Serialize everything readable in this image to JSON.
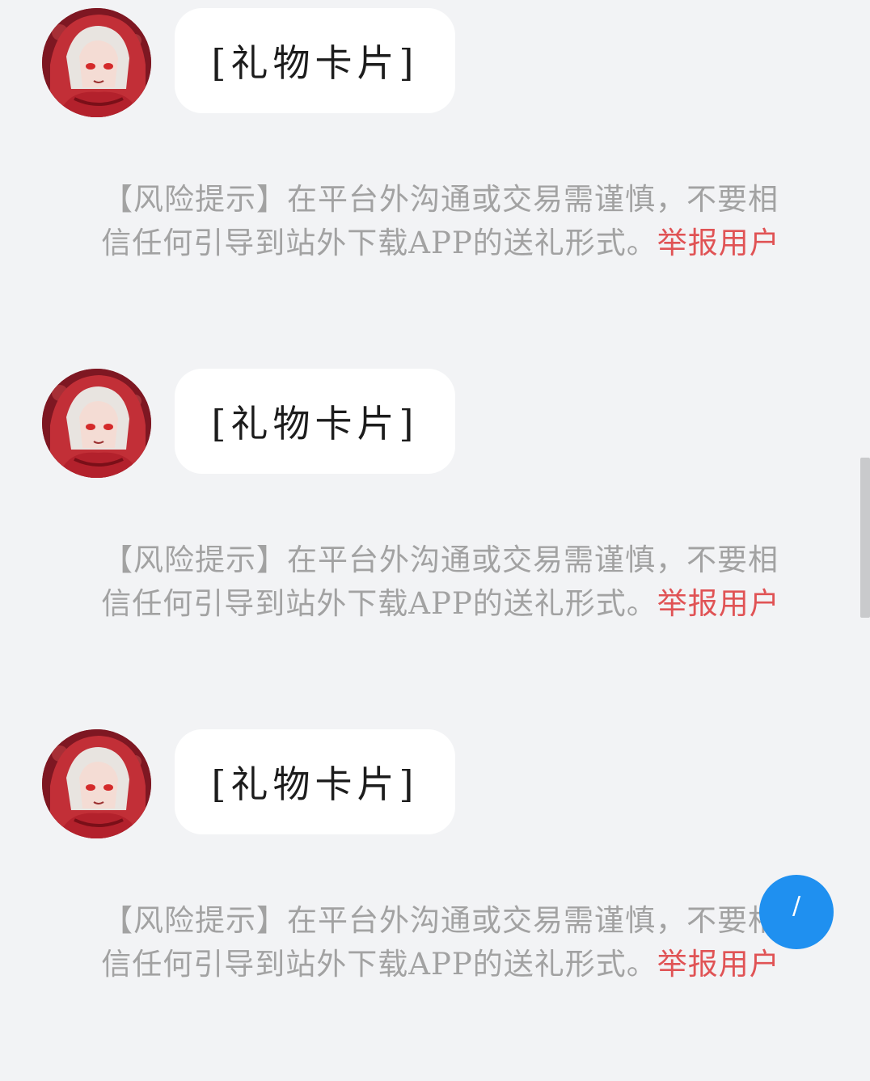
{
  "messages": [
    {
      "bubble_text": "[礼物卡片]",
      "risk_text": "【风险提示】在平台外沟通或交易需谨慎，不要相信任何引导到站外下载APP的送礼形式。",
      "report_label": "举报用户"
    },
    {
      "bubble_text": "[礼物卡片]",
      "risk_text": "【风险提示】在平台外沟通或交易需谨慎，不要相信任何引导到站外下载APP的送礼形式。",
      "report_label": "举报用户"
    },
    {
      "bubble_text": "[礼物卡片]",
      "risk_text": "【风险提示】在平台外沟通或交易需谨慎，不要相信任何引导到站外下载APP的送礼形式。",
      "report_label": "举报用户"
    }
  ],
  "floating_button": {
    "icon": "pen-icon",
    "label": "/"
  },
  "colors": {
    "background": "#f2f3f5",
    "bubble": "#ffffff",
    "risk_text": "#a2a2a2",
    "report_link": "#e05355",
    "fab": "#1f90f0"
  }
}
